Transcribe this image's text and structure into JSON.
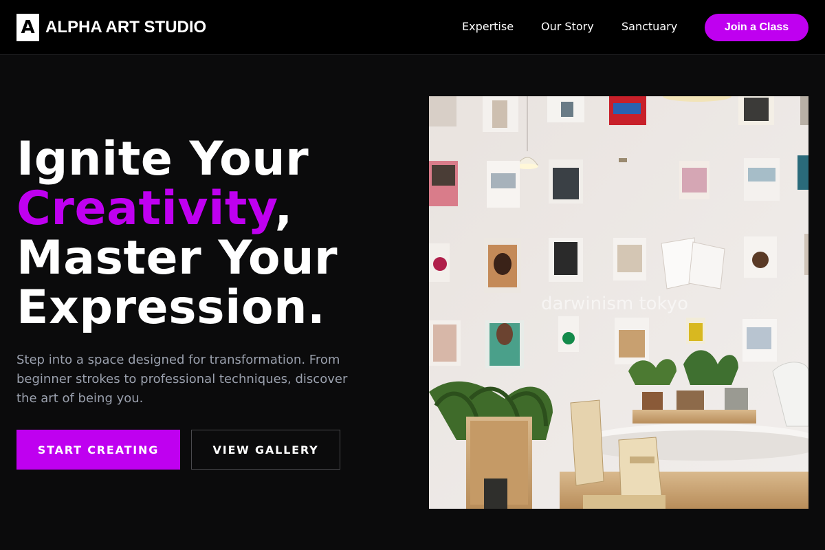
{
  "brand": {
    "mark": "A",
    "name": "ALPHA ART STUDIO"
  },
  "nav": {
    "items": [
      "Expertise",
      "Our Story",
      "Sanctuary"
    ],
    "cta": "Join a Class"
  },
  "hero": {
    "headline": {
      "line1": "Ignite Your",
      "accent": "Creativity",
      "accent_suffix": ",",
      "line3": "Master Your",
      "line4": "Expression."
    },
    "subtext": "Step into a space designed for transformation. From beginner strokes to professional techniques, discover the art of being you.",
    "primary_button": "START CREATING",
    "secondary_button": "VIEW GALLERY",
    "image": {
      "watermark": "darwinism tokyo"
    }
  },
  "colors": {
    "accent": "#bf00f0",
    "background": "#0b0b0c",
    "header_bg": "#000000",
    "muted_text": "#9aa0ad"
  }
}
